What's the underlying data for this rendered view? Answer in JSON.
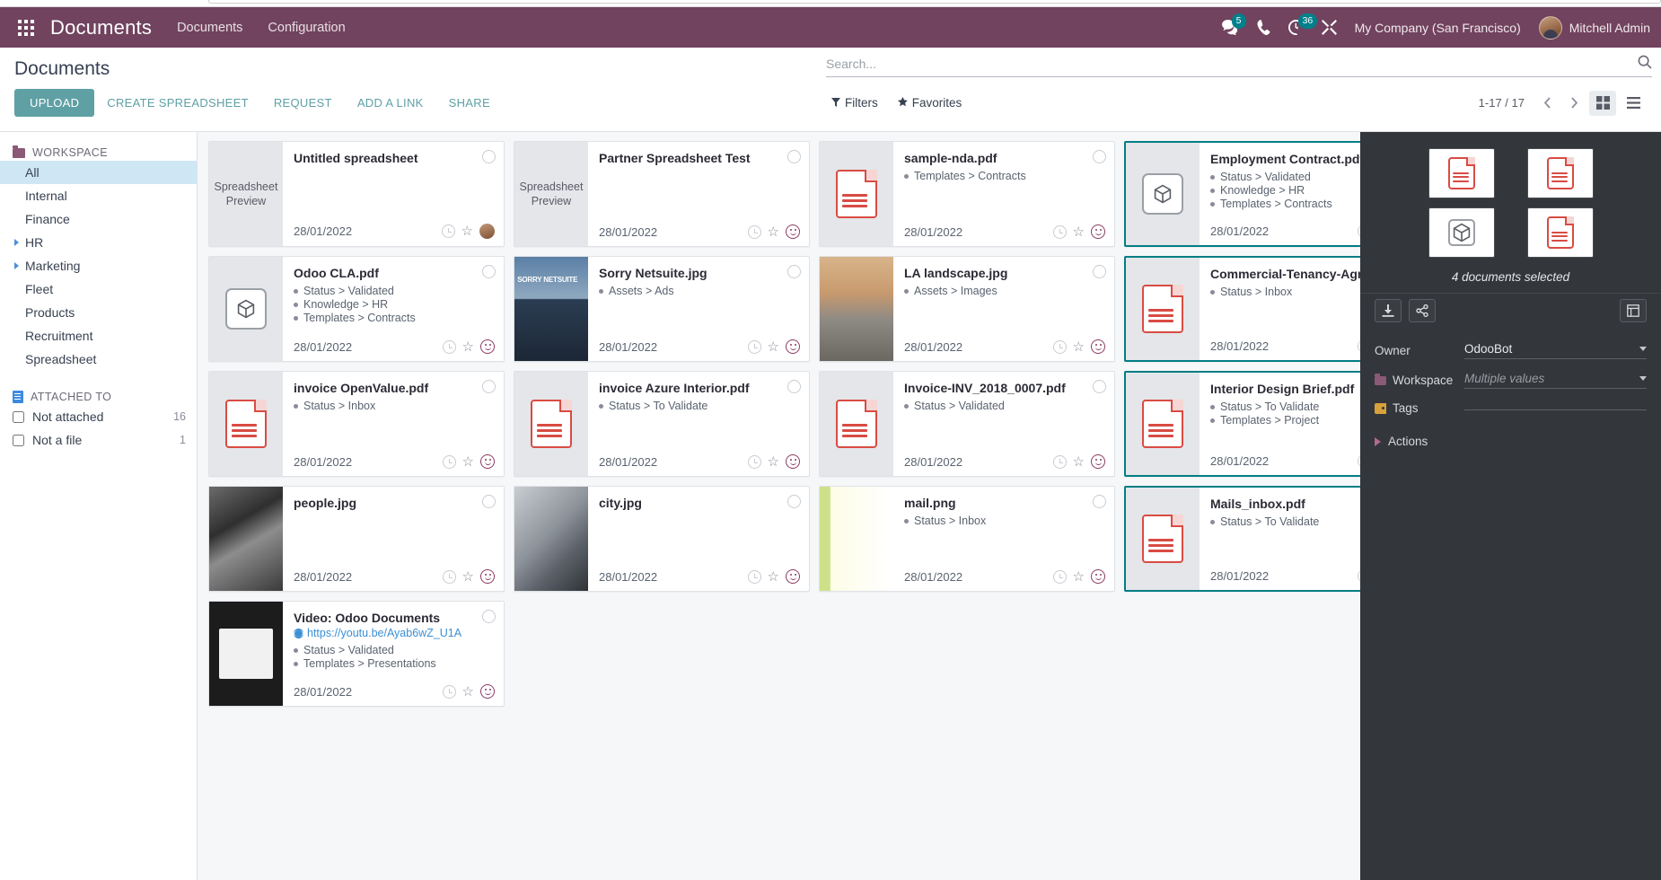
{
  "navbar": {
    "brand": "Documents",
    "menu": [
      {
        "label": "Documents"
      },
      {
        "label": "Configuration"
      }
    ],
    "messages_badge": "5",
    "activities_badge": "36",
    "company": "My Company (San Francisco)",
    "user": "Mitchell Admin"
  },
  "control_panel": {
    "title": "Documents",
    "buttons": [
      {
        "label": "UPLOAD",
        "style": "primary"
      },
      {
        "label": "CREATE SPREADSHEET",
        "style": "link"
      },
      {
        "label": "REQUEST",
        "style": "link"
      },
      {
        "label": "ADD A LINK",
        "style": "link"
      },
      {
        "label": "SHARE",
        "style": "link"
      }
    ],
    "search_placeholder": "Search...",
    "search_value": "",
    "filters_label": "Filters",
    "favorites_label": "Favorites",
    "pager": "1-17 / 17"
  },
  "sidebar": {
    "workspace_header": "WORKSPACE",
    "workspace_items": [
      {
        "label": "All",
        "active": true,
        "expandable": false
      },
      {
        "label": "Internal",
        "active": false,
        "expandable": false
      },
      {
        "label": "Finance",
        "active": false,
        "expandable": false
      },
      {
        "label": "HR",
        "active": false,
        "expandable": true
      },
      {
        "label": "Marketing",
        "active": false,
        "expandable": true
      },
      {
        "label": "Fleet",
        "active": false,
        "expandable": false
      },
      {
        "label": "Products",
        "active": false,
        "expandable": false
      },
      {
        "label": "Recruitment",
        "active": false,
        "expandable": false
      },
      {
        "label": "Spreadsheet",
        "active": false,
        "expandable": false
      }
    ],
    "attached_header": "ATTACHED TO",
    "attached_items": [
      {
        "label": "Not attached",
        "count": "16"
      },
      {
        "label": "Not a file",
        "count": "1"
      }
    ]
  },
  "documents": [
    {
      "title": "Untitled spreadsheet",
      "thumb": "spreadsheet-preview",
      "thumb_text": "Spreadsheet Preview",
      "tags": [],
      "date": "28/01/2022",
      "selected": false,
      "has_avatar": true,
      "url": ""
    },
    {
      "title": "Partner Spreadsheet Test",
      "thumb": "spreadsheet-preview",
      "thumb_text": "Spreadsheet Preview",
      "tags": [],
      "date": "28/01/2022",
      "selected": false,
      "has_avatar": false,
      "url": ""
    },
    {
      "title": "sample-nda.pdf",
      "thumb": "pdf",
      "thumb_text": "",
      "tags": [
        "Templates > Contracts"
      ],
      "date": "28/01/2022",
      "selected": false,
      "has_avatar": false,
      "url": ""
    },
    {
      "title": "Employment Contract.pdf",
      "thumb": "box",
      "thumb_text": "",
      "tags": [
        "Status > Validated",
        "Knowledge > HR",
        "Templates > Contracts"
      ],
      "date": "28/01/2022",
      "selected": true,
      "has_avatar": false,
      "url": ""
    },
    {
      "title": "Odoo CLA.pdf",
      "thumb": "box",
      "thumb_text": "",
      "tags": [
        "Status > Validated",
        "Knowledge > HR",
        "Templates > Contracts"
      ],
      "date": "28/01/2022",
      "selected": false,
      "has_avatar": false,
      "url": ""
    },
    {
      "title": "Sorry Netsuite.jpg",
      "thumb": "img-netsuite",
      "thumb_text": "",
      "tags": [
        "Assets > Ads"
      ],
      "date": "28/01/2022",
      "selected": false,
      "has_avatar": false,
      "url": ""
    },
    {
      "title": "LA landscape.jpg",
      "thumb": "img-la",
      "thumb_text": "",
      "tags": [
        "Assets > Images"
      ],
      "date": "28/01/2022",
      "selected": false,
      "has_avatar": false,
      "url": ""
    },
    {
      "title": "Commercial-Tenancy-Agreem...",
      "thumb": "pdf",
      "thumb_text": "",
      "tags": [
        "Status > Inbox"
      ],
      "date": "28/01/2022",
      "selected": true,
      "has_avatar": false,
      "url": ""
    },
    {
      "title": "invoice OpenValue.pdf",
      "thumb": "pdf",
      "thumb_text": "",
      "tags": [
        "Status > Inbox"
      ],
      "date": "28/01/2022",
      "selected": false,
      "has_avatar": false,
      "url": ""
    },
    {
      "title": "invoice Azure Interior.pdf",
      "thumb": "pdf",
      "thumb_text": "",
      "tags": [
        "Status > To Validate"
      ],
      "date": "28/01/2022",
      "selected": false,
      "has_avatar": false,
      "url": ""
    },
    {
      "title": "Invoice-INV_2018_0007.pdf",
      "thumb": "pdf",
      "thumb_text": "",
      "tags": [
        "Status > Validated"
      ],
      "date": "28/01/2022",
      "selected": false,
      "has_avatar": false,
      "url": ""
    },
    {
      "title": "Interior Design Brief.pdf",
      "thumb": "pdf",
      "thumb_text": "",
      "tags": [
        "Status > To Validate",
        "Templates > Project"
      ],
      "date": "28/01/2022",
      "selected": true,
      "has_avatar": false,
      "url": ""
    },
    {
      "title": "people.jpg",
      "thumb": "img-people",
      "thumb_text": "",
      "tags": [],
      "date": "28/01/2022",
      "selected": false,
      "has_avatar": false,
      "url": ""
    },
    {
      "title": "city.jpg",
      "thumb": "img-city",
      "thumb_text": "",
      "tags": [],
      "date": "28/01/2022",
      "selected": false,
      "has_avatar": false,
      "url": ""
    },
    {
      "title": "mail.png",
      "thumb": "img-mail",
      "thumb_text": "",
      "tags": [
        "Status > Inbox"
      ],
      "date": "28/01/2022",
      "selected": false,
      "has_avatar": false,
      "url": ""
    },
    {
      "title": "Mails_inbox.pdf",
      "thumb": "pdf",
      "thumb_text": "",
      "tags": [
        "Status > To Validate"
      ],
      "date": "28/01/2022",
      "selected": true,
      "has_avatar": false,
      "url": ""
    },
    {
      "title": "Video: Odoo Documents",
      "thumb": "img-video",
      "thumb_text": "",
      "tags": [
        "Status > Validated",
        "Templates > Presentations"
      ],
      "date": "28/01/2022",
      "selected": false,
      "has_avatar": false,
      "url": "https://youtu.be/Ayab6wZ_U1A"
    }
  ],
  "inspector": {
    "previews": [
      "pdf",
      "pdf",
      "box",
      "pdf"
    ],
    "selection_text": "4 documents selected",
    "fields": [
      {
        "name": "owner",
        "label": "Owner",
        "value": "OdooBot",
        "placeholder": false,
        "icon": ""
      },
      {
        "name": "workspace",
        "label": "Workspace",
        "value": "Multiple values",
        "placeholder": true,
        "icon": "folder-icon"
      },
      {
        "name": "tags",
        "label": "Tags",
        "value": "",
        "placeholder": false,
        "icon": "tag-icon"
      }
    ],
    "actions_label": "Actions"
  },
  "colors": {
    "brand_purple": "#71435f",
    "accent_teal": "#5fa0a5",
    "selected_border": "#017e84",
    "badge_teal": "#00808a",
    "sidebar_active": "#cfe7f5",
    "inspector_bg": "#33363b"
  }
}
